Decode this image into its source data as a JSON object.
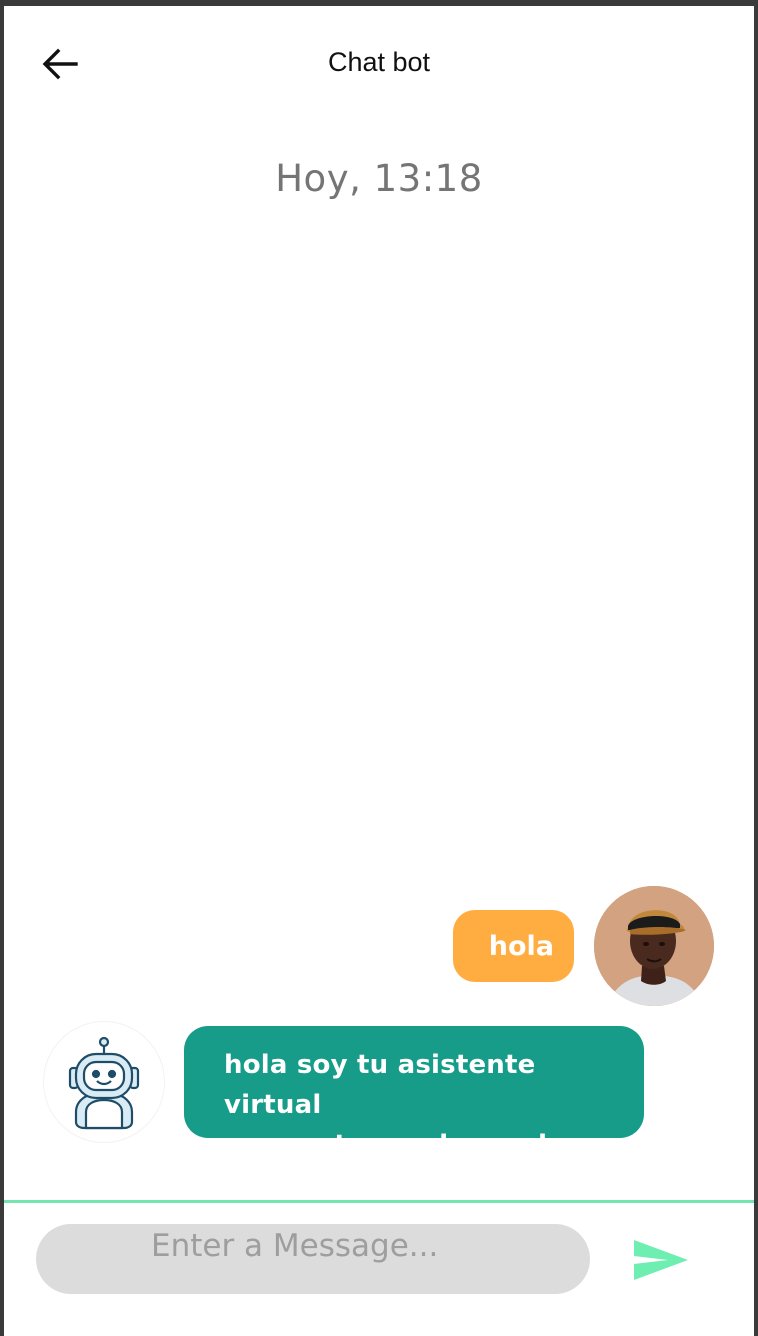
{
  "app_bar": {
    "title": "Chat bot",
    "back_icon": "arrow-left-icon"
  },
  "conversation": {
    "timestamp": "Hoy, 13:18",
    "messages": [
      {
        "sender": "user",
        "text": "hola",
        "bubble_color": "#ffac41",
        "avatar": "user-photo-avatar"
      },
      {
        "sender": "bot",
        "text": "hola soy tu asistente virtual\nen que te puedo ayudar",
        "bubble_color": "#169c89",
        "avatar": "robot-icon"
      }
    ]
  },
  "composer": {
    "placeholder": "Enter a Message...",
    "value": "",
    "send_icon": "send-icon",
    "send_color": "#6eeeb0",
    "divider_color": "#74e4b0",
    "field_color": "#dcdcdc"
  }
}
